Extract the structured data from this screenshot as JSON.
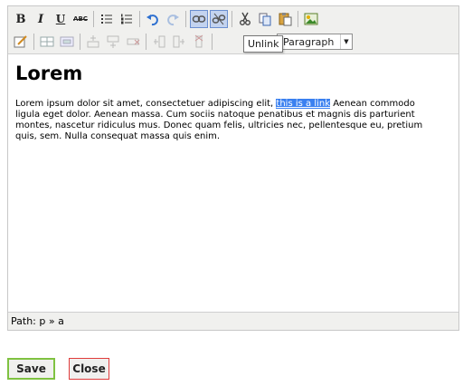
{
  "toolbar": {
    "row1": [
      {
        "name": "bold-button",
        "label": "B",
        "kind": "b"
      },
      {
        "name": "italic-button",
        "label": "I",
        "kind": "i"
      },
      {
        "name": "underline-button",
        "label": "U",
        "kind": "u"
      },
      {
        "name": "strikethrough-button",
        "label": "ABC",
        "kind": "abc"
      },
      {
        "name": "bullet-list-button",
        "icon": "bullet-list-icon"
      },
      {
        "name": "numbered-list-button",
        "icon": "numbered-list-icon"
      },
      {
        "name": "undo-button",
        "icon": "undo-icon"
      },
      {
        "name": "redo-button",
        "icon": "redo-icon"
      },
      {
        "name": "link-button",
        "icon": "link-icon",
        "active": true
      },
      {
        "name": "unlink-button",
        "icon": "unlink-icon",
        "active": true
      },
      {
        "name": "cut-button",
        "icon": "scissors-icon"
      },
      {
        "name": "copy-button",
        "icon": "copy-icon"
      },
      {
        "name": "paste-button",
        "icon": "paste-icon"
      },
      {
        "name": "image-button",
        "icon": "image-icon"
      }
    ],
    "row2_icons": [
      "edit-icon",
      "table-icon",
      "table-properties-icon",
      "insert-row-before-icon",
      "insert-row-after-icon",
      "delete-row-icon",
      "insert-col-before-icon",
      "insert-col-after-icon",
      "delete-col-icon"
    ],
    "format_select": {
      "value": "Paragraph"
    },
    "tooltip": "Unlink"
  },
  "content": {
    "heading": "Lorem",
    "para_before": " Lorem ipsum dolor sit amet, consectetuer adipiscing elit, ",
    "link_text": "this is a link",
    "para_after": " Aenean commodo ligula eget dolor. Aenean massa. Cum sociis natoque penatibus et magnis dis parturient montes, nascetur ridiculus mus. Donec quam felis, ultricies nec, pellentesque eu, pretium quis, sem. Nulla consequat massa quis enim."
  },
  "status": {
    "path": "Path: p » a"
  },
  "actions": {
    "save": "Save",
    "close": "Close"
  },
  "colors": {
    "save_border": "#7fc241",
    "close_border": "#e03c3c",
    "selection": "#3a80f0",
    "toolbar_bg": "#f0f0ee"
  }
}
